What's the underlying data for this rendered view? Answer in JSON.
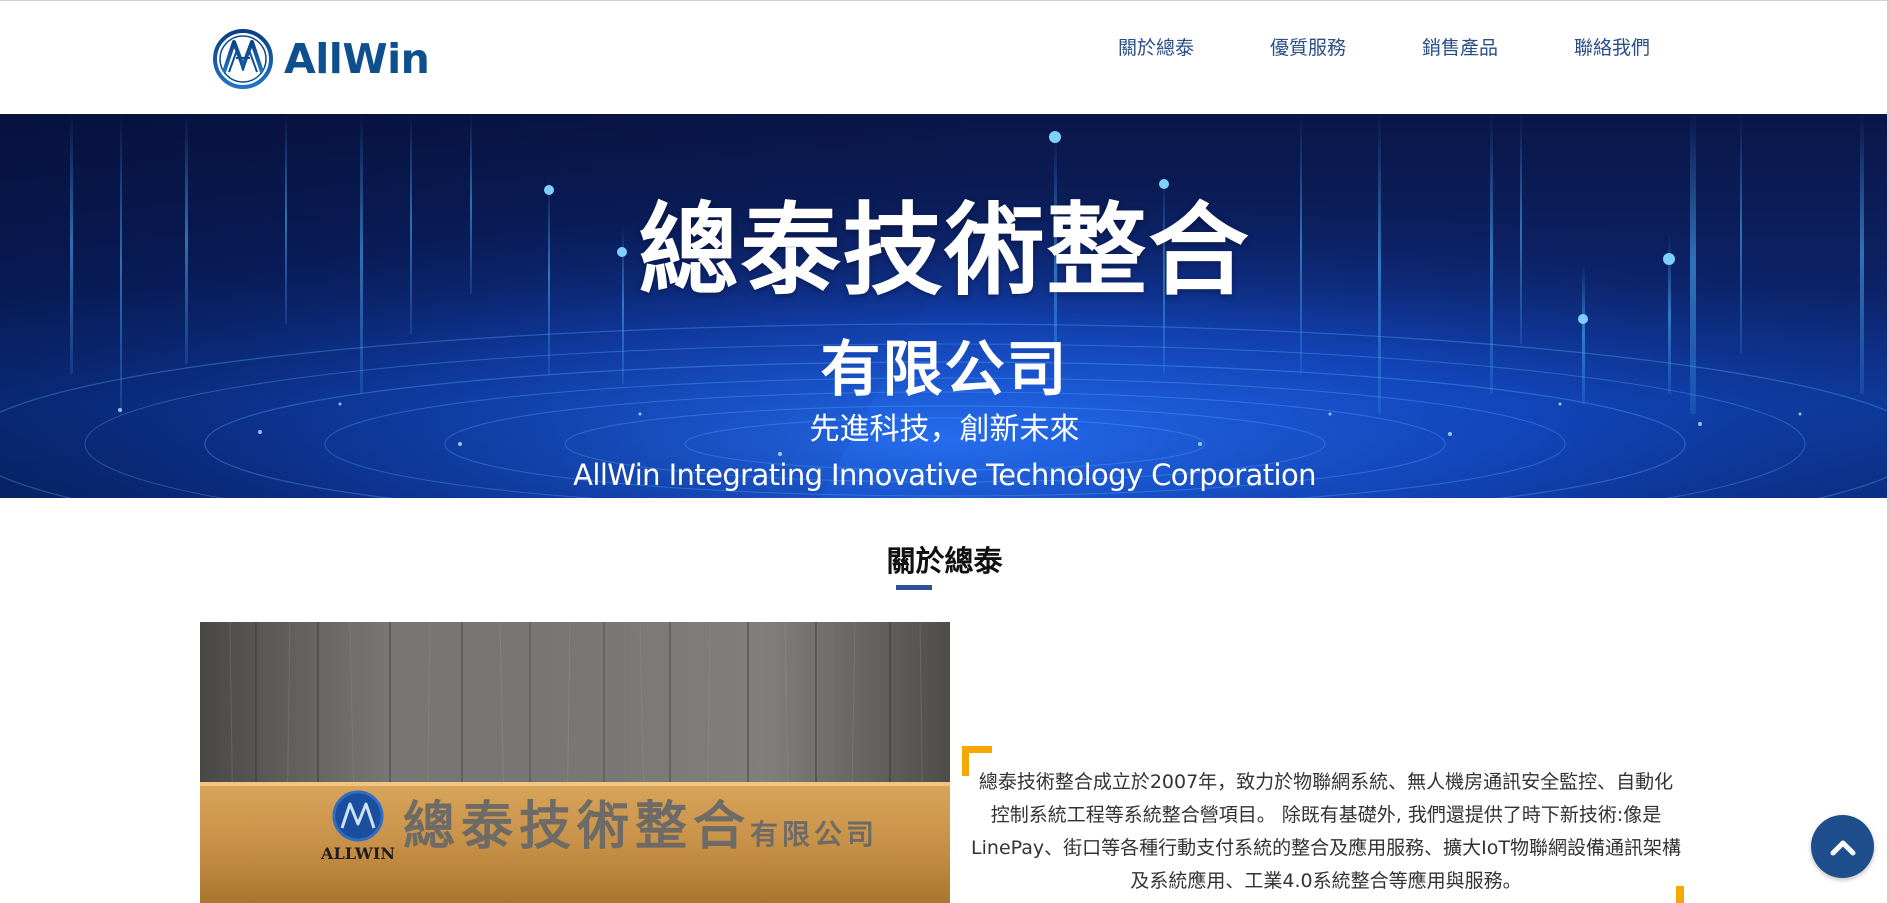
{
  "header": {
    "logo_text": "AllWin",
    "nav": [
      {
        "label": "關於總泰"
      },
      {
        "label": "優質服務"
      },
      {
        "label": "銷售產品"
      },
      {
        "label": "聯絡我們"
      }
    ]
  },
  "hero": {
    "title": "總泰技術整合",
    "subtitle": "有限公司",
    "slogan": "先進科技，創新未來",
    "english_name": "AllWin Integrating Innovative Technology Corporation"
  },
  "about": {
    "heading": "關於總泰",
    "photo": {
      "sign_text": "總泰技術整合",
      "sign_suffix": "有限公司",
      "sign_logo_text": "ALLWIN"
    },
    "paragraph": "總泰技術整合成立於2007年，致力於物聯網系統、無人機房通訊安全監控、自動化控制系統工程等系統整合營項目。 除既有基礎外, 我們還提供了時下新技術:像是LinePay、街口等各種行動支付系統的整合及應用服務、擴大IoT物聯網設備通訊架構及系統應用、工業4.0系統整合等應用與服務。"
  },
  "icons": {
    "scroll_top": "chevron-up-icon",
    "logo": "allwin-logo-icon"
  },
  "colors": {
    "brand_blue": "#0d4f8f",
    "nav_text": "#2a4f86",
    "accent_orange": "#f6a800",
    "heading_underline": "#2d4f9a",
    "scroll_button": "#1f4e8c"
  }
}
